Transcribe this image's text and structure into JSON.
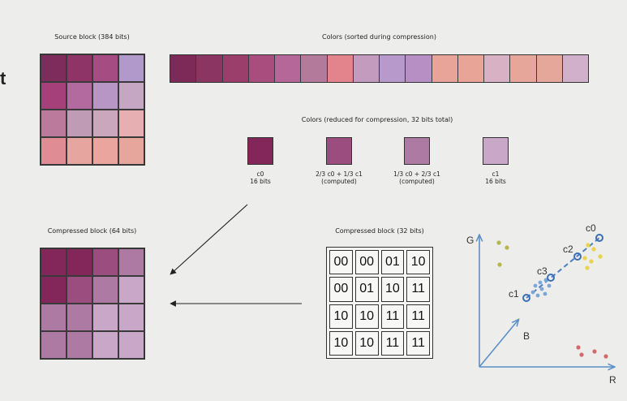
{
  "edge_letter": "t",
  "source": {
    "title": "Source block (384 bits)",
    "cells": [
      "#7e2c5c",
      "#8e3466",
      "#a54c82",
      "#b19acb",
      "#a6407a",
      "#b36a9e",
      "#b796c6",
      "#c5a7c4",
      "#bb7a9c",
      "#c09bb6",
      "#cba7bd",
      "#e6b0b2",
      "#e08c94",
      "#e7a5a0",
      "#e9a59e",
      "#e7a69b"
    ]
  },
  "sorted": {
    "title": "Colors (sorted during compression)",
    "colors": [
      "#7d2a58",
      "#8b3563",
      "#9c3e6c",
      "#a84d7e",
      "#b6679a",
      "#b47a9b",
      "#e3838c",
      "#c39bbe",
      "#b79acb",
      "#b88fc4",
      "#e9a49a",
      "#e8a597",
      "#d8b1c4",
      "#e6a79a",
      "#e6a79b",
      "#d1b0cc"
    ]
  },
  "reduced": {
    "title": "Colors (reduced for compression, 32 bits total)",
    "swatches": [
      {
        "color": "#83275a",
        "label": "c0\n16 bits"
      },
      {
        "color": "#9c4d80",
        "label": "2/3 c0 + 1/3 c1\n(computed)"
      },
      {
        "color": "#ac7aa2",
        "label": "1/3 c0 + 2/3 c1\n(computed)"
      },
      {
        "color": "#c9a7c9",
        "label": "c1\n16 bits"
      }
    ]
  },
  "compressed64": {
    "title": "Compressed block (64 bits)",
    "cells": [
      "#83275a",
      "#83275a",
      "#9c4d80",
      "#ac7aa2",
      "#83275a",
      "#9c4d80",
      "#ac7aa2",
      "#c9a7c9",
      "#ac7aa2",
      "#ac7aa2",
      "#c9a7c9",
      "#c9a7c9",
      "#ac7aa2",
      "#ac7aa2",
      "#c9a7c9",
      "#c9a7c9"
    ]
  },
  "compressed32": {
    "title": "Compressed block (32 bits)",
    "indices": [
      "00",
      "00",
      "01",
      "10",
      "00",
      "01",
      "10",
      "11",
      "10",
      "10",
      "11",
      "11",
      "10",
      "10",
      "11",
      "11"
    ]
  },
  "rgb_plot": {
    "axis_g": "G",
    "axis_r": "R",
    "axis_b": "B",
    "labels": {
      "c0": "c0",
      "c1": "c1",
      "c2": "c2",
      "c3": "c3"
    },
    "colors": {
      "axis": "#5b90c8",
      "blue": "#4f7fc0",
      "yellow": "#e8d44a",
      "green": "#b6b64a",
      "red": "#d36a6a"
    }
  }
}
